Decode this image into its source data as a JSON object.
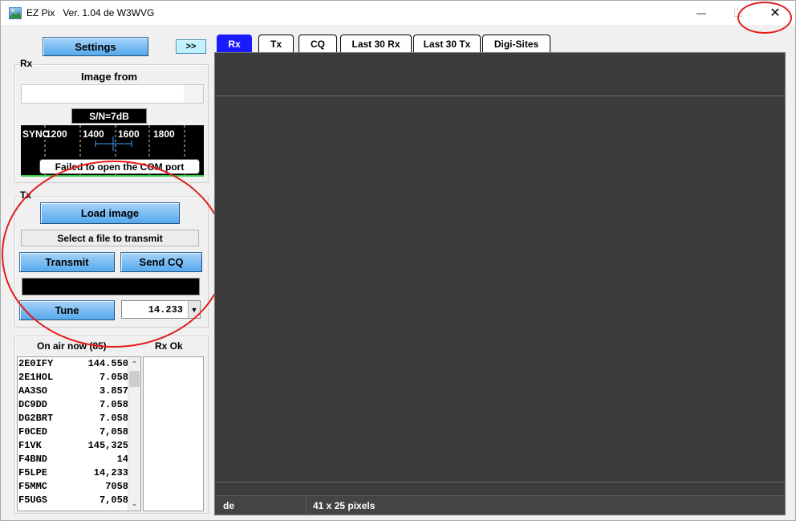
{
  "window": {
    "title": "EZ Pix   Ver. 1.04 de W3WVG",
    "minimize_glyph": "—",
    "maximize_glyph": "☐",
    "close_glyph": "✕"
  },
  "toolbar": {
    "settings_label": "Settings",
    "expand_label": ">>"
  },
  "rx": {
    "group_label": "Rx",
    "image_from_label": "Image from",
    "image_from_value": "",
    "snr": "S/N=7dB",
    "waterfall_labels": [
      "SYNC",
      "1200",
      "1400",
      "1600",
      "1800"
    ],
    "error_message": "Failed to open the COM port"
  },
  "tx": {
    "group_label": "Tx",
    "load_image_label": "Load image",
    "file_status": "Select a file to transmit",
    "transmit_label": "Transmit",
    "send_cq_label": "Send CQ",
    "tune_label": "Tune",
    "frequency": "14.233",
    "progress": 0
  },
  "onair": {
    "header": "On air now (85)",
    "rx_ok_header": "Rx Ok",
    "stations": [
      {
        "call": "2E0IFY",
        "freq": "144.550"
      },
      {
        "call": "2E1HOL",
        "freq": "7.058"
      },
      {
        "call": "AA3SO",
        "freq": "3.857"
      },
      {
        "call": "DC9DD",
        "freq": "7.058"
      },
      {
        "call": "DG2BRT",
        "freq": "7.058"
      },
      {
        "call": "F0CED",
        "freq": "7,058"
      },
      {
        "call": "F1VK",
        "freq": "145,325"
      },
      {
        "call": "F4BND",
        "freq": "14"
      },
      {
        "call": "F5LPE",
        "freq": "14,233"
      },
      {
        "call": "F5MMC",
        "freq": "7058"
      },
      {
        "call": "F5UGS",
        "freq": "7,058"
      }
    ],
    "rx_ok": []
  },
  "tabs": [
    {
      "label": "Rx",
      "active": true
    },
    {
      "label": "Tx",
      "active": false
    },
    {
      "label": "CQ",
      "active": false
    },
    {
      "label": "Last 30 Rx",
      "active": false
    },
    {
      "label": "Last 30 Tx",
      "active": false
    },
    {
      "label": "Digi-Sites",
      "active": false
    }
  ],
  "status": {
    "from": "de",
    "size": "41 x 25 pixels"
  },
  "colors": {
    "accent_blue": "#1a1aff",
    "button_blue": "#55a9ee",
    "annotation_red": "#e51b1b",
    "display_background": "#3c3c3c"
  }
}
